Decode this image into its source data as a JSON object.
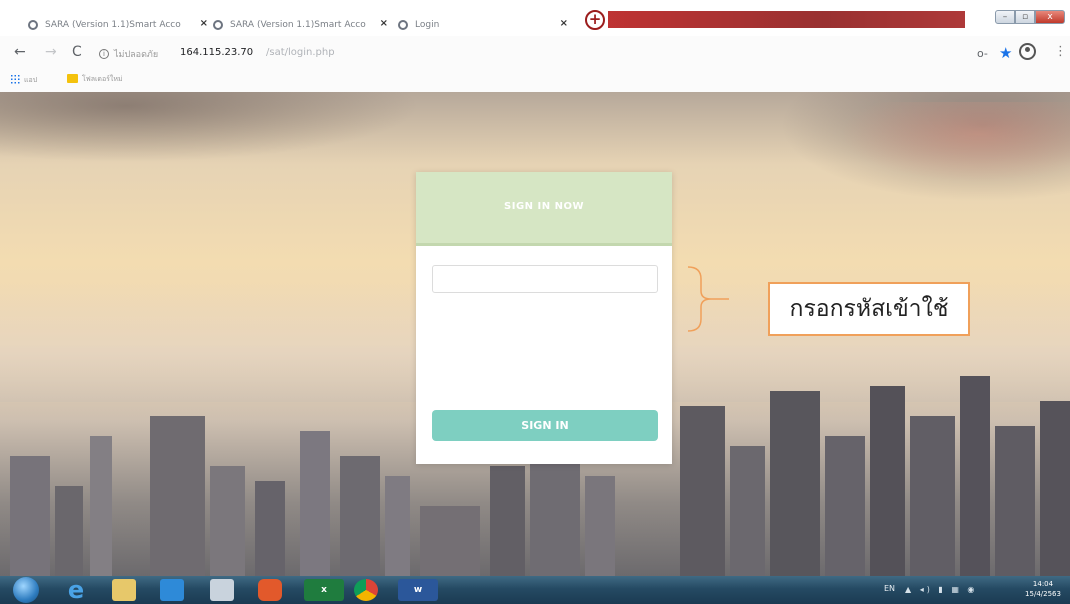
{
  "browser": {
    "tabs": [
      {
        "label": "SARA (Version 1.1)Smart Acco",
        "close": "×"
      },
      {
        "label": "SARA (Version 1.1)Smart Acco",
        "close": "×"
      },
      {
        "label": "Login",
        "close": "×"
      }
    ],
    "new_tab": "+",
    "window_buttons": {
      "minimize": "–",
      "maximize": "▫",
      "close": "x"
    },
    "nav": {
      "back": "←",
      "forward": "→",
      "reload": "C"
    },
    "url": {
      "security": "ไม่ปลอดภัย",
      "host": "164.115.23.70",
      "path": "/sat/login.php"
    },
    "bookmarks": {
      "apps_label": "แอป",
      "folder_label": "โฟลเดอร์ใหม่"
    },
    "toolbar": {
      "key": "o-",
      "star": "★",
      "menu": "⋮"
    }
  },
  "login": {
    "title": "SIGN IN NOW",
    "code_value": "",
    "code_placeholder": "",
    "signin_label": "SIGN IN"
  },
  "annotation": {
    "text": "กรอกรหัสเข้าใช้"
  },
  "taskbar": {
    "excel_label": "x",
    "word_label": "w",
    "language": "EN",
    "tray": "▲ ◂) ▮ ▦ ◉",
    "time": "14:04",
    "date": "15/4/2563"
  },
  "colors": {
    "header": "#d6e6c4",
    "button": "#7ecfc1",
    "annotation_border": "#f0a05a",
    "taskbar": "#254a63"
  }
}
